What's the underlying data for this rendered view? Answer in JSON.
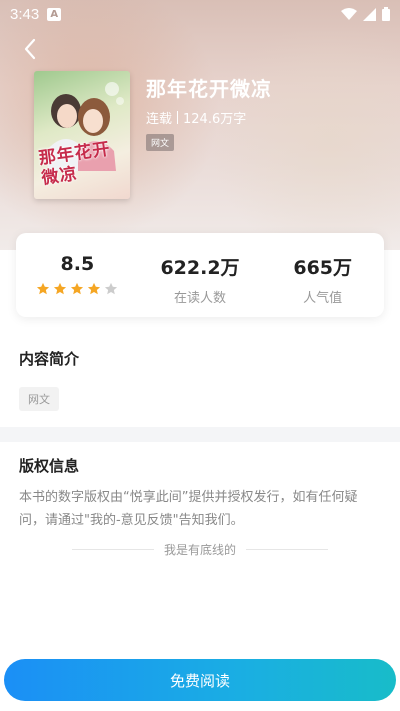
{
  "status_bar": {
    "time": "3:43",
    "notification_badge": "A"
  },
  "book": {
    "title": "那年花开微凉",
    "status": "连载",
    "word_count": "124.6万字",
    "category_tag": "网文",
    "cover_title_text": "那年花开微凉"
  },
  "stats": {
    "rating": "8.5",
    "rating_stars": 4,
    "rating_stars_max": 5,
    "readers_value": "622.2万",
    "readers_label": "在读人数",
    "popularity_value": "665万",
    "popularity_label": "人气值"
  },
  "intro": {
    "title": "内容简介",
    "tag": "网文"
  },
  "copyright": {
    "title": "版权信息",
    "text": "本书的数字版权由“悦享此间”提供并授权发行，如有任何疑问，请通过\"我的-意见反馈\"告知我们。",
    "bottom_line": "我是有底线的"
  },
  "action": {
    "read_button": "免费阅读"
  },
  "colors": {
    "accent_start": "#1b8ff6",
    "accent_end": "#18bcc9",
    "star": "#f5a623",
    "star_empty": "#cccccc"
  }
}
